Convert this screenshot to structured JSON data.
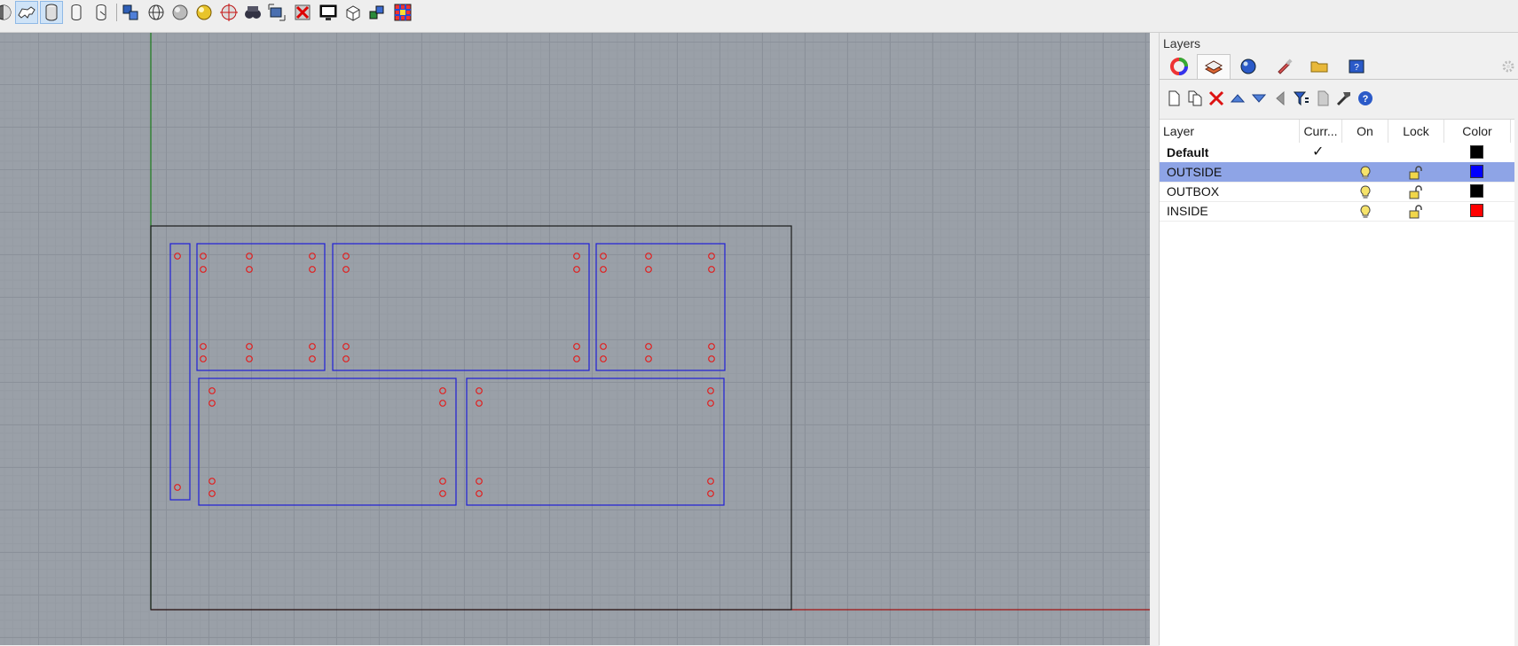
{
  "toolbar": {
    "buttons": [
      "sphere-half-icon",
      "walking-cat-icon",
      "cylinder-select-icon",
      "cylinder-icon",
      "cylinder-cursor-icon",
      "layers-cubes-icon",
      "wire-globe-icon",
      "shaded-sphere-icon",
      "rendered-sphere-icon",
      "target-sphere-icon",
      "binoculars-icon",
      "camera-target-icon",
      "close-viewport-icon",
      "monitor-icon",
      "box-icon",
      "material-cubes-icon",
      "grid-palette-icon"
    ]
  },
  "layers_panel": {
    "title": "Layers",
    "tabs": [
      "color-wheel-icon",
      "layers-tab-icon",
      "render-sphere-icon",
      "brush-icon",
      "folder-icon",
      "help-panel-icon"
    ],
    "tools": [
      "new-layer-icon",
      "new-sublayer-icon",
      "delete-icon",
      "move-up-icon",
      "move-down-icon",
      "previous-icon",
      "filter-icon",
      "document-icon",
      "tools-icon",
      "help-icon"
    ],
    "columns": {
      "layer": "Layer",
      "current": "Curr...",
      "on": "On",
      "lock": "Lock",
      "color": "Color"
    },
    "rows": [
      {
        "name": "Default",
        "current": "✓",
        "on": false,
        "lock": false,
        "color": "#000000",
        "bold": true,
        "selected": false
      },
      {
        "name": "OUTSIDE",
        "current": "",
        "on": true,
        "lock": true,
        "color": "#0000ff",
        "bold": false,
        "selected": true
      },
      {
        "name": "OUTBOX",
        "current": "",
        "on": true,
        "lock": true,
        "color": "#000000",
        "bold": false,
        "selected": false
      },
      {
        "name": "INSIDE",
        "current": "",
        "on": true,
        "lock": true,
        "color": "#ff0000",
        "bold": false,
        "selected": false
      }
    ]
  },
  "colors": {
    "outline": "#1f1fd6",
    "holes": "#e02020",
    "frame": "#1a1a1a",
    "x_axis": "#a01010",
    "y_axis": "#1a7a1a"
  }
}
